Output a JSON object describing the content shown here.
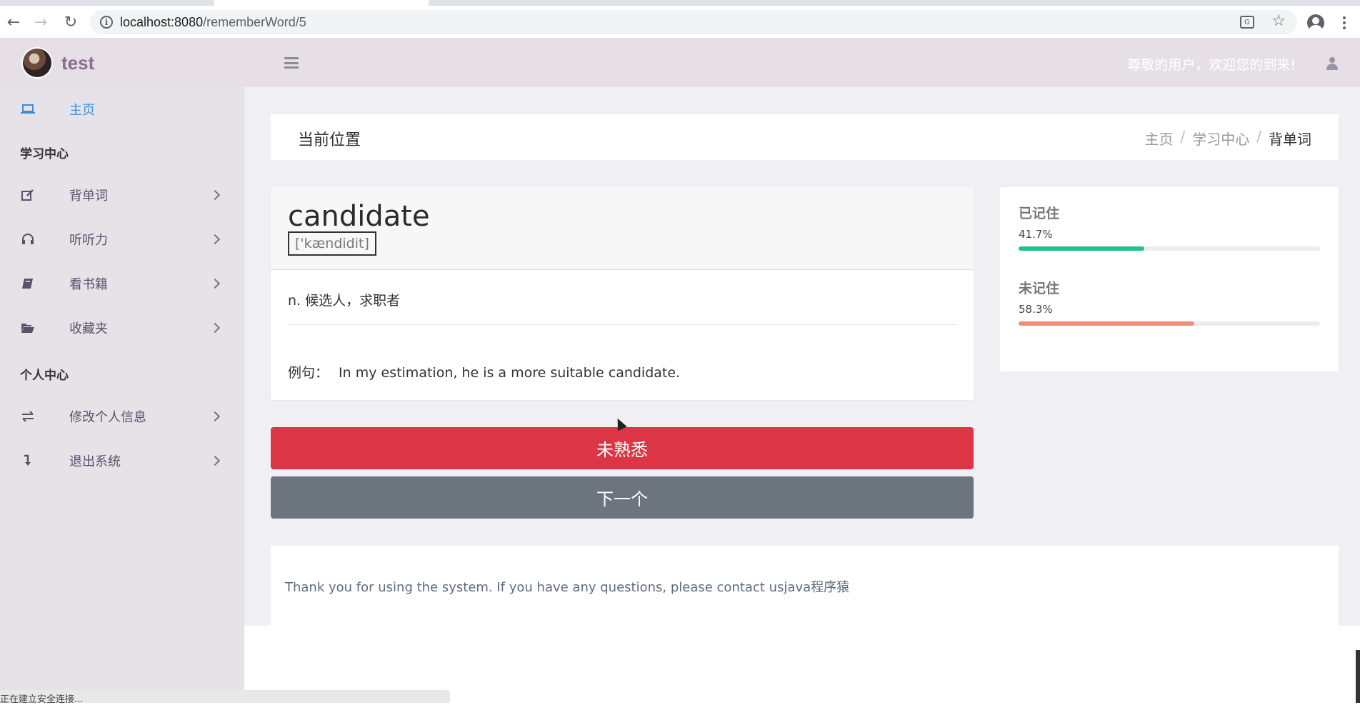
{
  "browser": {
    "url_host": "localhost:8080",
    "url_path": "/rememberWord/5"
  },
  "header": {
    "brand": "test",
    "welcome": "尊敬的用户，欢迎您的到来!"
  },
  "sidebar": {
    "home": "主页",
    "section_study": "学习中心",
    "study_items": [
      "背单词",
      "听听力",
      "看书籍",
      "收藏夹"
    ],
    "section_personal": "个人中心",
    "personal_items": [
      "修改个人信息",
      "退出系统"
    ]
  },
  "breadcrumb": {
    "title": "当前位置",
    "trail": [
      "主页",
      "学习中心",
      "背单词"
    ]
  },
  "word_card": {
    "word": "candidate",
    "phonetic": "['kændidit]",
    "meaning": "n. 候选人，求职者",
    "example_label": "例句：",
    "example": "In my estimation, he is a more suitable candidate."
  },
  "actions": {
    "unfamiliar": "未熟悉",
    "next": "下一个"
  },
  "stats": {
    "remembered_label": "已记住",
    "remembered_value": "41.7%",
    "remembered_fraction": 0.417,
    "remembered_color": "#20c08f",
    "not_remembered_label": "未记住",
    "not_remembered_value": "58.3%",
    "not_remembered_fraction": 0.583,
    "not_remembered_color": "#ef8f76"
  },
  "footer": {
    "text": "Thank you for using the system. If you have any questions, please contact usjava程序猿"
  },
  "status_bar": {
    "text": "正在建立安全连接..."
  }
}
